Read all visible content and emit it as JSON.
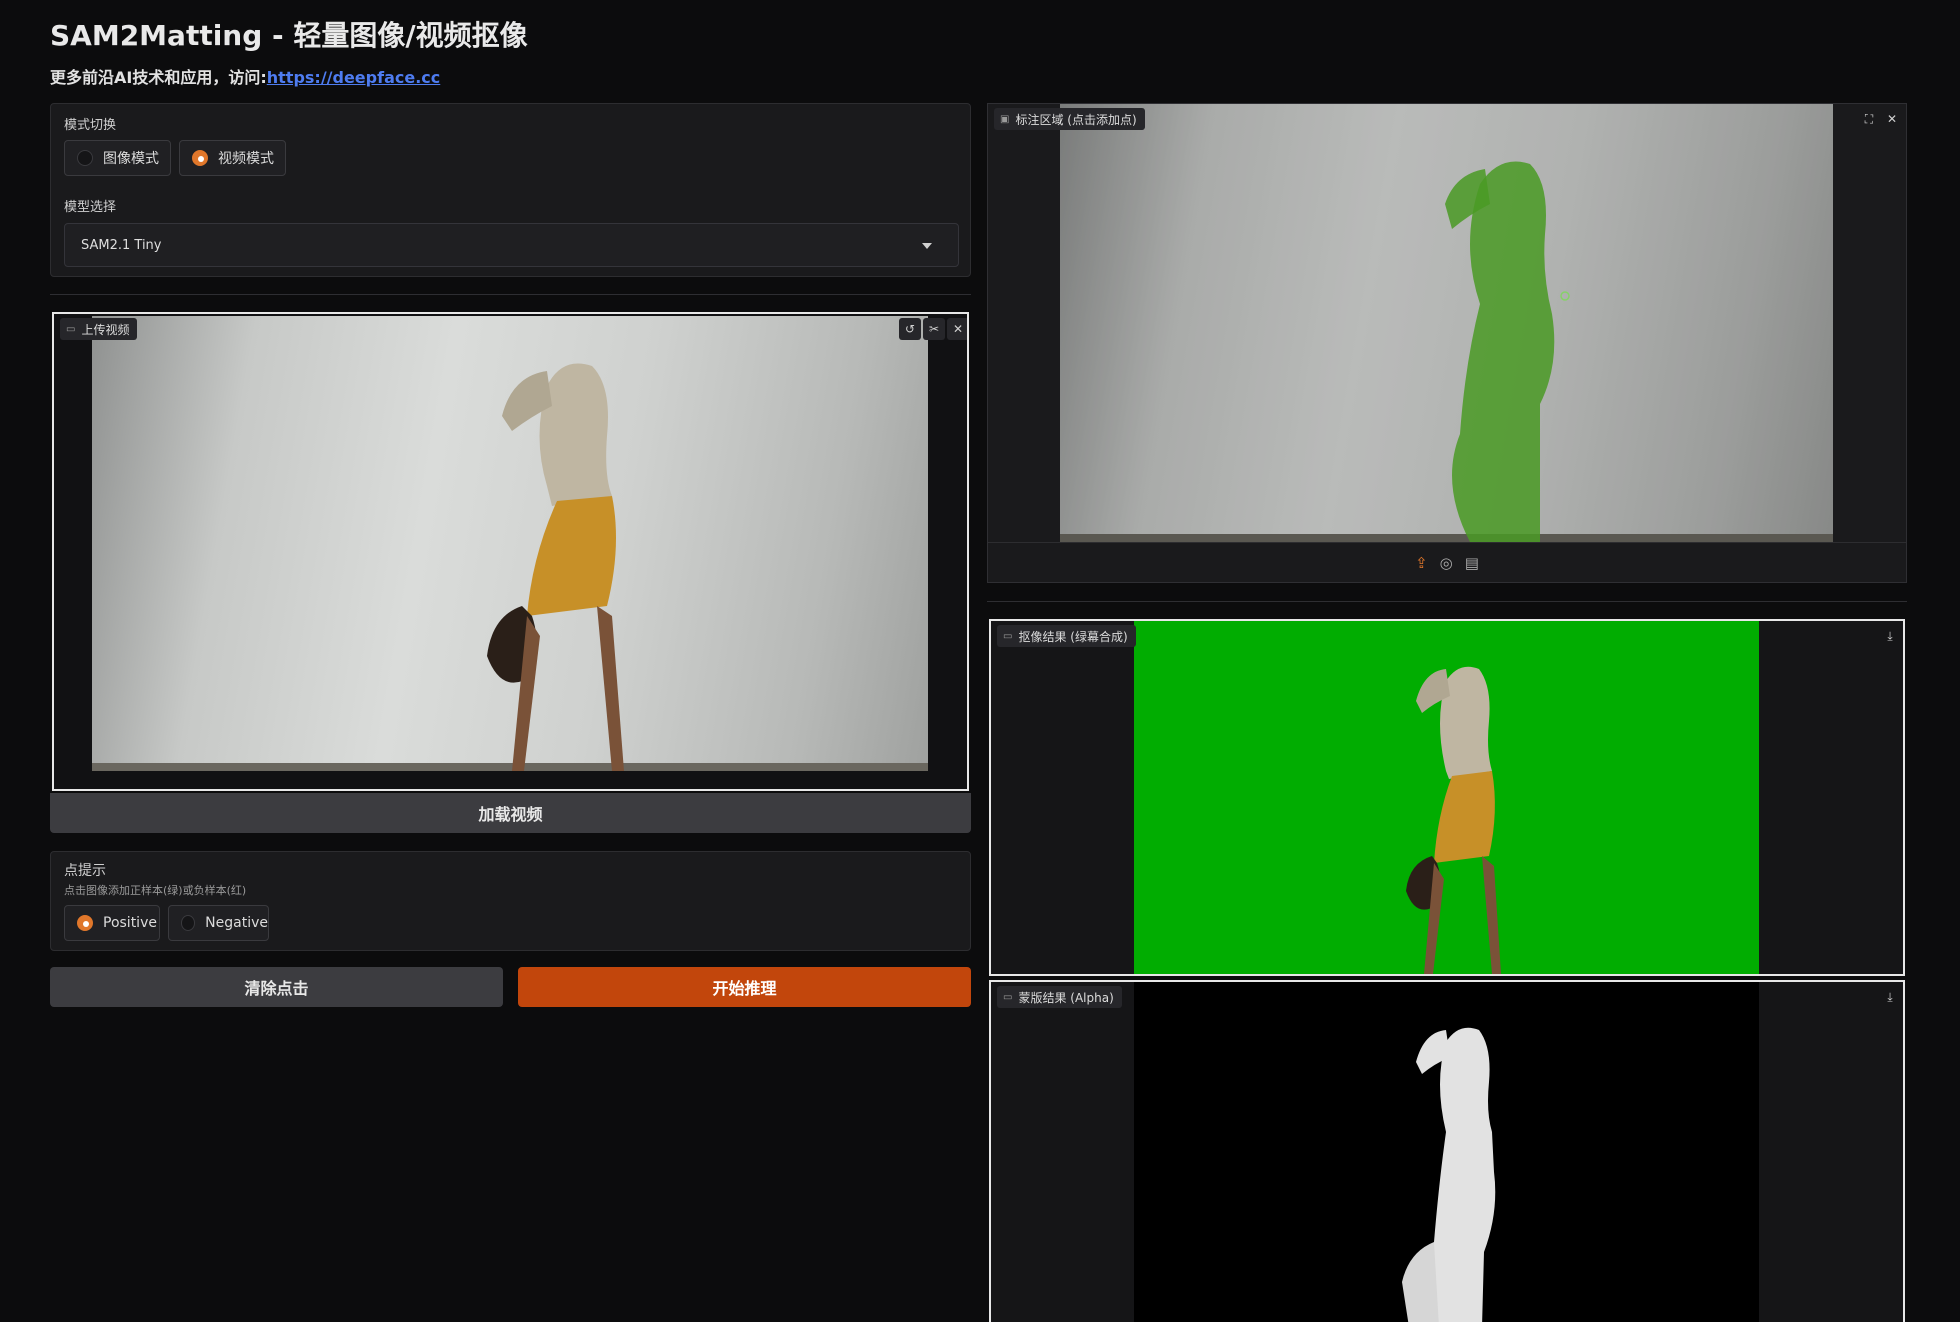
{
  "header": {
    "title": "SAM2Matting - 轻量图像/视频抠像",
    "subtitle_prefix": "更多前沿AI技术和应用，访问:",
    "subtitle_link": "https://deepface.cc"
  },
  "mode": {
    "label": "模式切换",
    "options": [
      {
        "label": "图像模式",
        "selected": false
      },
      {
        "label": "视频模式",
        "selected": true
      }
    ]
  },
  "model": {
    "label": "模型选择",
    "selected": "SAM2.1 Tiny"
  },
  "upload": {
    "tag": "上传视频",
    "load_button": "加载视频"
  },
  "points": {
    "label": "点提示",
    "hint": "点击图像添加正样本(绿)或负样本(红)",
    "options": [
      {
        "label": "Positive",
        "selected": true
      },
      {
        "label": "Negative",
        "selected": false
      }
    ]
  },
  "actions": {
    "clear": "清除点击",
    "run": "开始推理"
  },
  "annotate": {
    "tag": "标注区域 (点击添加点)"
  },
  "result_green": {
    "tag": "抠像结果 (绿幕合成)"
  },
  "result_alpha": {
    "tag": "蒙版结果 (Alpha)"
  },
  "colors": {
    "accent": "#e0772b",
    "primary_button": "#c2460c",
    "greenscreen": "#01ad01",
    "link": "#4e7cf0"
  }
}
